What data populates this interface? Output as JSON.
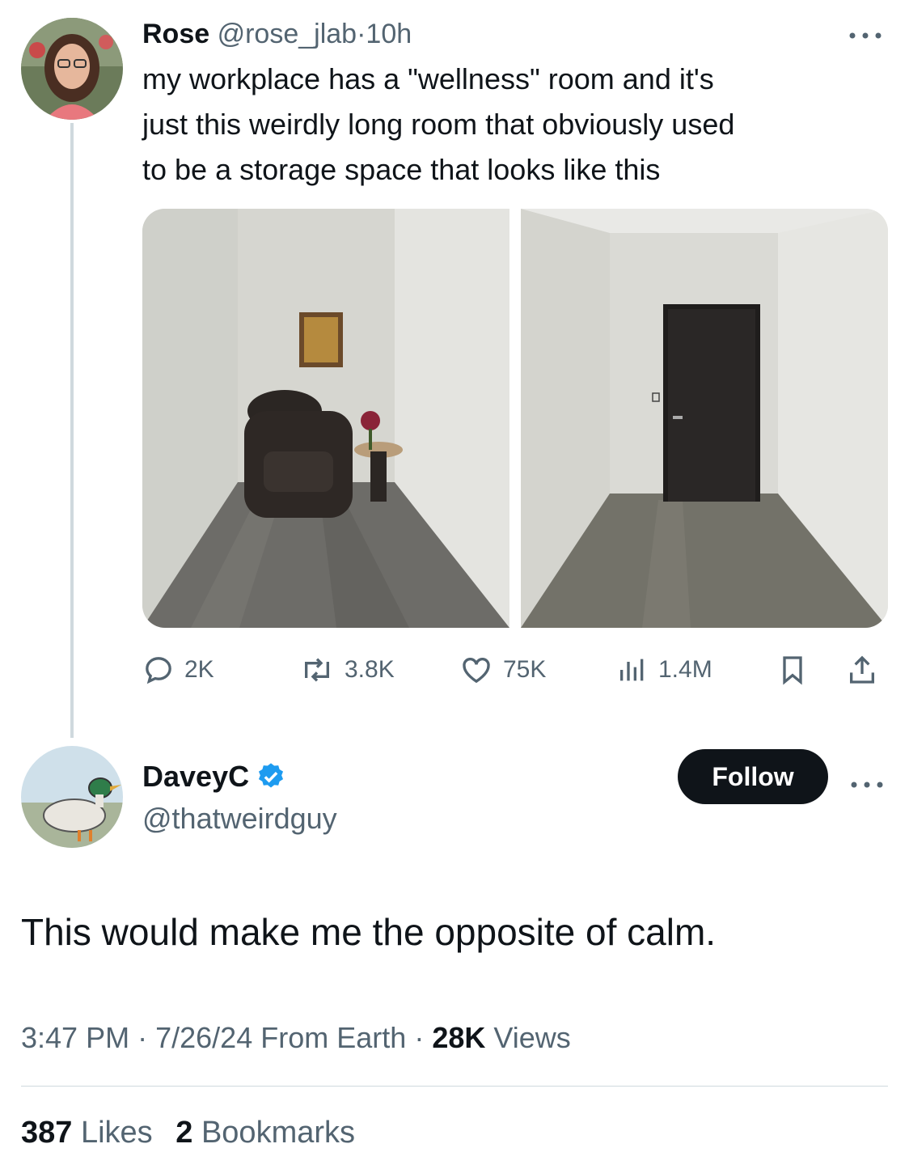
{
  "original_tweet": {
    "author_name": "Rose",
    "handle": "@rose_jlab",
    "separator": "·",
    "time_ago": "10h",
    "text_lines": [
      "my workplace has a \"wellness\" room and it's",
      "just this weirdly long room that obviously used",
      "to be a storage space that looks like this"
    ],
    "more_icon": "more-horizontal-icon",
    "actions": {
      "replies": "2K",
      "reposts": "3.8K",
      "likes": "75K",
      "views": "1.4M"
    }
  },
  "reply_tweet": {
    "author_name": "DaveyC",
    "verified": true,
    "handle": "@thatweirdguy",
    "follow_label": "Follow",
    "text": "This would make me the opposite of calm.",
    "time": "3:47 PM",
    "date": "7/26/24",
    "source": "From Earth",
    "sep": "·",
    "views_count": "28K",
    "views_label": "Views",
    "likes_count": "387",
    "likes_label": "Likes",
    "bookmarks_count": "2",
    "bookmarks_label": "Bookmarks"
  },
  "colors": {
    "text": "#0f1419",
    "muted": "#536471",
    "verified_blue": "#1d9bf0",
    "follow_bg": "#0f1419"
  }
}
